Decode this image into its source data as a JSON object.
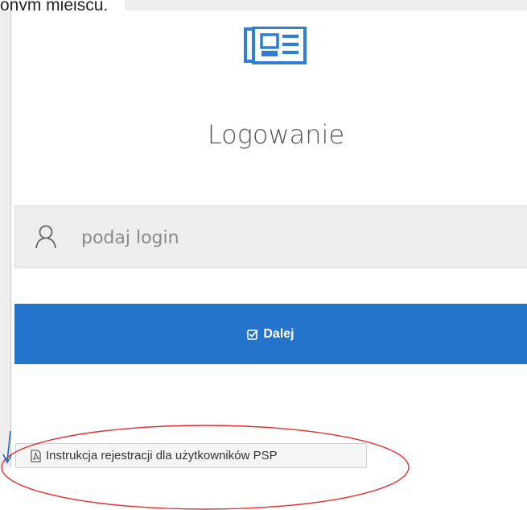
{
  "top_text": "onym miejscu.",
  "page_title": "Logowanie",
  "login": {
    "placeholder": "podaj login",
    "value": ""
  },
  "next_button": {
    "label": "Dalej"
  },
  "instruction_button": {
    "label": "Instrukcja rejestracji dla użytkowników PSP"
  },
  "icons": {
    "logo": "newspaper-icon",
    "user": "user-icon",
    "check": "check-square-icon",
    "pdf": "file-pdf-icon"
  },
  "colors": {
    "accent": "#2474cc",
    "annotation_ellipse": "#e03030",
    "annotation_arrow": "#2b6cb0"
  }
}
